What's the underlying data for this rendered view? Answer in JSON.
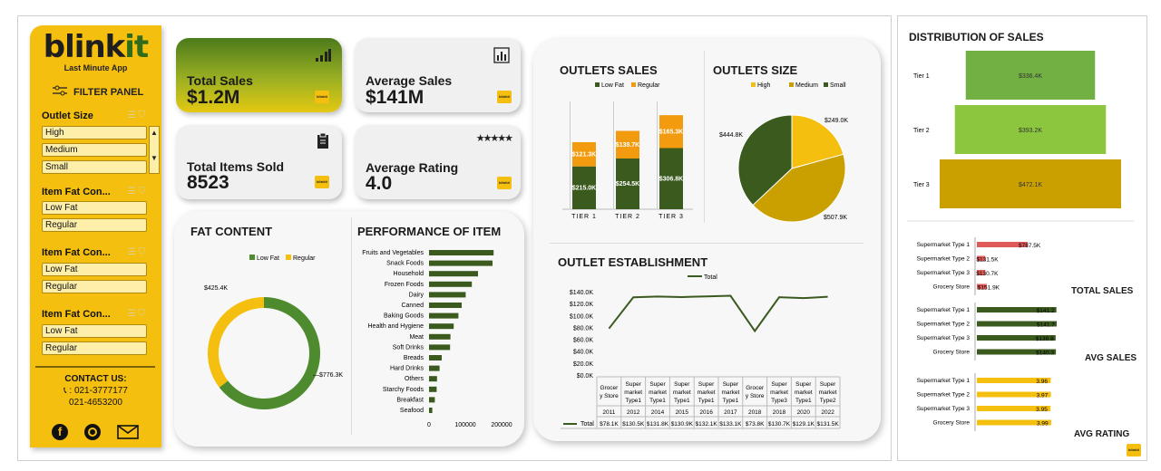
{
  "sidebar": {
    "logo_main": "blink",
    "logo_accent": "it",
    "tagline": "Last Minute App",
    "filter_panel_label": "FILTER PANEL",
    "slicers": [
      {
        "title": "Outlet Size",
        "options": [
          "High",
          "Medium",
          "Small"
        ]
      },
      {
        "title": "Item Fat Con...",
        "options": [
          "Low Fat",
          "Regular"
        ]
      },
      {
        "title": "Item Fat Con...",
        "options": [
          "Low Fat",
          "Regular"
        ]
      },
      {
        "title": "Item Fat Con...",
        "options": [
          "Low Fat",
          "Regular"
        ]
      }
    ],
    "contact_title": "CONTACT US:",
    "phone1": "021-3777177",
    "phone2": "021-4653200"
  },
  "kpis": {
    "total_sales_label": "Total Sales",
    "total_sales_value": "$1.2M",
    "avg_sales_label": "Average Sales",
    "avg_sales_value": "$141M",
    "items_sold_label": "Total Items Sold",
    "items_sold_value": "8523",
    "avg_rating_label": "Average Rating",
    "avg_rating_value": "4.0",
    "badge_text": "blinkit"
  },
  "titles": {
    "fat_content": "FAT CONTENT",
    "performance": "PERFORMANCE OF ITEM",
    "outlets_sales": "OUTLETS SALES",
    "outlets_size": "OUTLETS SIZE",
    "establishment": "OUTLET ESTABLISHMENT",
    "distribution": "DISTRIBUTION OF SALES",
    "total_sales": "TOTAL SALES",
    "avg_sales": "AVG SALES",
    "avg_rating": "AVG RATING"
  },
  "colors": {
    "yellow": "#f5bf0f",
    "dark_green": "#3a5a1e",
    "green": "#4e8a2e",
    "light_green": "#8cc63f",
    "mustard": "#c9a000",
    "red": "#e05a5a"
  },
  "chart_data": [
    {
      "id": "fat_content",
      "type": "pie",
      "style": "donut",
      "legend": [
        "Low Fat",
        "Regular"
      ],
      "values": [
        776.3,
        425.4
      ],
      "labels": [
        "$776.3K",
        "$425.4K"
      ]
    },
    {
      "id": "performance",
      "type": "bar",
      "orientation": "horizontal",
      "categories": [
        "Fruits and Vegetables",
        "Snack Foods",
        "Household",
        "Frozen Foods",
        "Dairy",
        "Canned",
        "Baking Goods",
        "Health and Hygiene",
        "Meat",
        "Soft Drinks",
        "Breads",
        "Hard Drinks",
        "Others",
        "Starchy Foods",
        "Breakfast",
        "Seafood"
      ],
      "values": [
        178000,
        175000,
        135000,
        118000,
        101000,
        90000,
        81000,
        68000,
        59000,
        58000,
        35000,
        29000,
        22000,
        21000,
        16000,
        9000
      ],
      "xticks": [
        "0",
        "100000",
        "200000"
      ],
      "xlim": [
        0,
        200000
      ]
    },
    {
      "id": "outlets_sales",
      "type": "bar",
      "stacked": true,
      "categories": [
        "TIER 1",
        "TIER 2",
        "TIER 3"
      ],
      "series": [
        {
          "name": "Low Fat",
          "values": [
            215.0,
            254.5,
            306.8
          ],
          "labels": [
            "$215.0K",
            "$254.5K",
            "$306.8K"
          ]
        },
        {
          "name": "Regular",
          "values": [
            121.3,
            138.7,
            165.3
          ],
          "labels": [
            "$121.3K",
            "$138.7K",
            "$165.3K"
          ]
        }
      ]
    },
    {
      "id": "outlets_size",
      "type": "pie",
      "legend": [
        "High",
        "Medium",
        "Small"
      ],
      "values": [
        249.0,
        507.9,
        444.8
      ],
      "labels": [
        "$249.0K",
        "$507.9K",
        "$444.8K"
      ]
    },
    {
      "id": "establishment",
      "type": "line",
      "legend": [
        "Total"
      ],
      "yticks": [
        "$0.0K",
        "$20.0K",
        "$40.0K",
        "$60.0K",
        "$80.0K",
        "$100.0K",
        "$120.0K",
        "$140.0K"
      ],
      "ylim": [
        0,
        140
      ],
      "categories": [
        {
          "type": "Grocery Store",
          "year": "2011"
        },
        {
          "type": "Supermarket Type1",
          "year": "2012"
        },
        {
          "type": "Supermarket Type1",
          "year": "2014"
        },
        {
          "type": "Supermarket Type1",
          "year": "2015"
        },
        {
          "type": "Supermarket Type1",
          "year": "2016"
        },
        {
          "type": "Supermarket Type1",
          "year": "2017"
        },
        {
          "type": "Grocery Store",
          "year": "2018"
        },
        {
          "type": "Supermarket Type3",
          "year": "2018"
        },
        {
          "type": "Supermarket Type1",
          "year": "2020"
        },
        {
          "type": "Supermarket Type2",
          "year": "2022"
        }
      ],
      "values": [
        78.1,
        130.5,
        131.8,
        130.9,
        132.1,
        133.1,
        73.8,
        130.7,
        129.1,
        131.5
      ],
      "table_labels": [
        "$78.1K",
        "$130.5K",
        "$131.8K",
        "$130.9K",
        "$132.1K",
        "$133.1K",
        "$73.8K",
        "$130.7K",
        "$129.1K",
        "$131.5K"
      ],
      "table_row_label": "Total"
    },
    {
      "id": "distribution",
      "type": "bar",
      "style": "funnel",
      "categories": [
        "Tier 1",
        "Tier 2",
        "Tier 3"
      ],
      "values": [
        336.4,
        393.2,
        472.1
      ],
      "labels": [
        "$336.4K",
        "$393.2K",
        "$472.1K"
      ]
    },
    {
      "id": "total_sales",
      "type": "bar",
      "orientation": "horizontal",
      "categories": [
        "Supermarket Type 1",
        "Supermarket Type 2",
        "Supermarket Type 3",
        "Grocery Store"
      ],
      "values": [
        787.5,
        131.5,
        130.7,
        151.9
      ],
      "labels": [
        "$787.5K",
        "$131.5K",
        "$130.7K",
        "$151.9K"
      ]
    },
    {
      "id": "avg_sales",
      "type": "bar",
      "orientation": "horizontal",
      "categories": [
        "Supermarket Type 1",
        "Supermarket Type 2",
        "Supermarket Type 3",
        "Grocery Store"
      ],
      "values": [
        141.2,
        141.7,
        139.8,
        140.3
      ],
      "labels": [
        "$141.2",
        "$141.7",
        "$139.8",
        "$140.3"
      ]
    },
    {
      "id": "avg_rating",
      "type": "bar",
      "orientation": "horizontal",
      "categories": [
        "Supermarket Type 1",
        "Supermarket Type 2",
        "Supermarket Type 3",
        "Grocery Store"
      ],
      "values": [
        3.96,
        3.97,
        3.95,
        3.99
      ],
      "labels": [
        "3.96",
        "3.97",
        "3.95",
        "3.99"
      ]
    }
  ]
}
